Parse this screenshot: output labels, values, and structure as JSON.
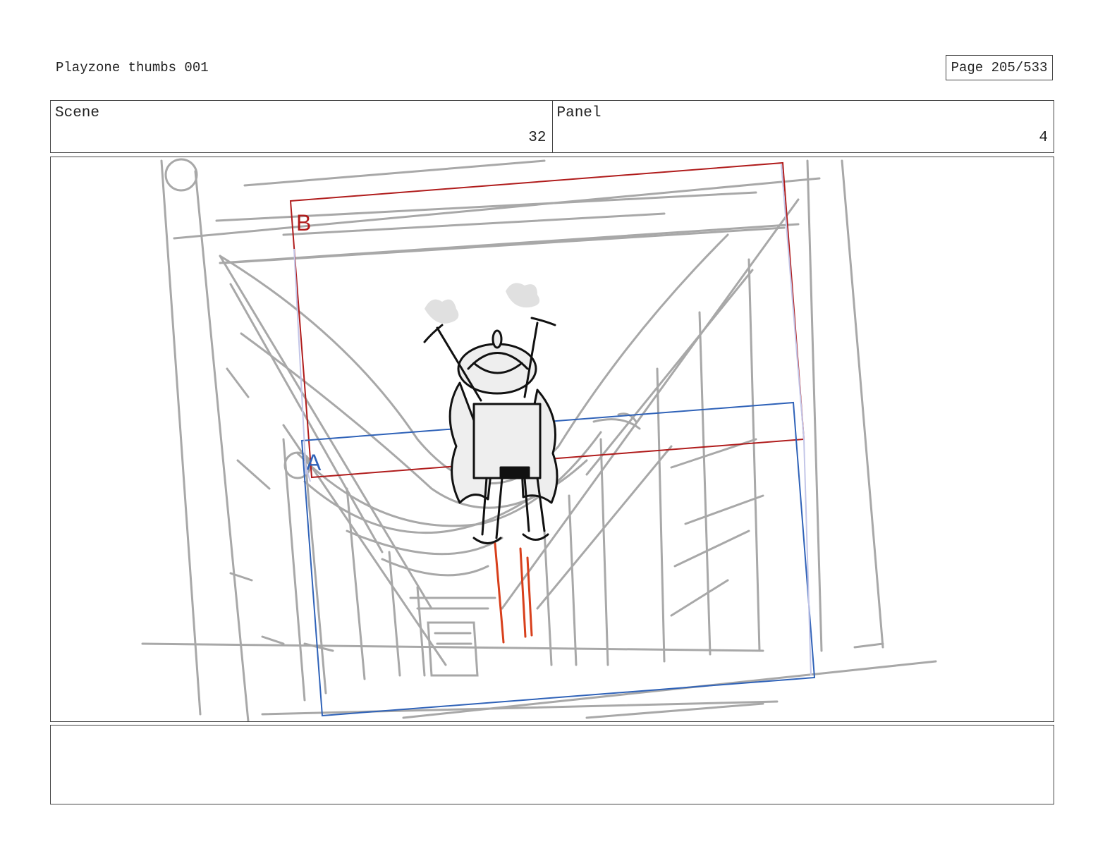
{
  "header": {
    "title": "Playzone thumbs 001",
    "page_label": "Page 205/533"
  },
  "info": {
    "scene_label": "Scene",
    "scene_value": "32",
    "panel_label": "Panel",
    "panel_value": "4"
  },
  "frame": {
    "camera_a_label": "A",
    "camera_b_label": "B",
    "colors": {
      "sketch": "#a8a8a8",
      "ink": "#111111",
      "camera_a": "#2f62b8",
      "camera_b": "#b01c1c",
      "speed_lines": "#d8401c"
    }
  },
  "notes": {
    "text": ""
  }
}
